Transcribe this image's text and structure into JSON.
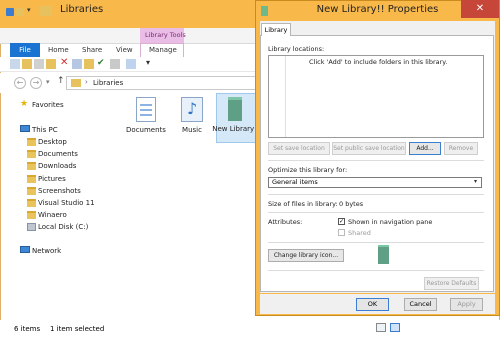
{
  "explorer": {
    "title": "Libraries",
    "ribbon": {
      "context_group": "Library Tools",
      "tabs": [
        "File",
        "Home",
        "Share",
        "View",
        "Manage"
      ]
    },
    "address": {
      "path": "Libraries"
    },
    "nav": {
      "favorites": "Favorites",
      "this_pc": "This PC",
      "items": [
        "Desktop",
        "Documents",
        "Downloads",
        "Pictures",
        "Screenshots",
        "Visual Studio 11",
        "Winaero",
        "Local Disk (C:)"
      ],
      "network": "Network"
    },
    "content_items": [
      {
        "label": "Documents",
        "icon": "documents-library-icon"
      },
      {
        "label": "Music",
        "icon": "music-library-icon"
      },
      {
        "label": "New Library!!",
        "icon": "new-library-icon"
      }
    ],
    "status": {
      "count": "6 items",
      "selected": "1 item selected"
    }
  },
  "dialog": {
    "title": "New Library!! Properties",
    "tab": "Library",
    "locations_label": "Library locations:",
    "locations_hint": "Click 'Add' to include folders in this library.",
    "buttons": {
      "set_save": "Set save location",
      "set_public": "Set public save location",
      "add": "Add...",
      "remove": "Remove"
    },
    "optimize_label": "Optimize this library for:",
    "optimize_value": "General items",
    "size_label": "Size of files in library:",
    "size_value": "0 bytes",
    "attributes_label": "Attributes:",
    "attr_nav": "Shown in navigation pane",
    "attr_shared": "Shared",
    "change_icon": "Change library icon...",
    "restore": "Restore Defaults",
    "ok": "OK",
    "cancel": "Cancel",
    "apply": "Apply"
  },
  "colors": {
    "titlebar": "#f9b84a",
    "file_tab": "#1a73d1",
    "library_tools": "#e9bde6",
    "close": "#c7463a"
  }
}
